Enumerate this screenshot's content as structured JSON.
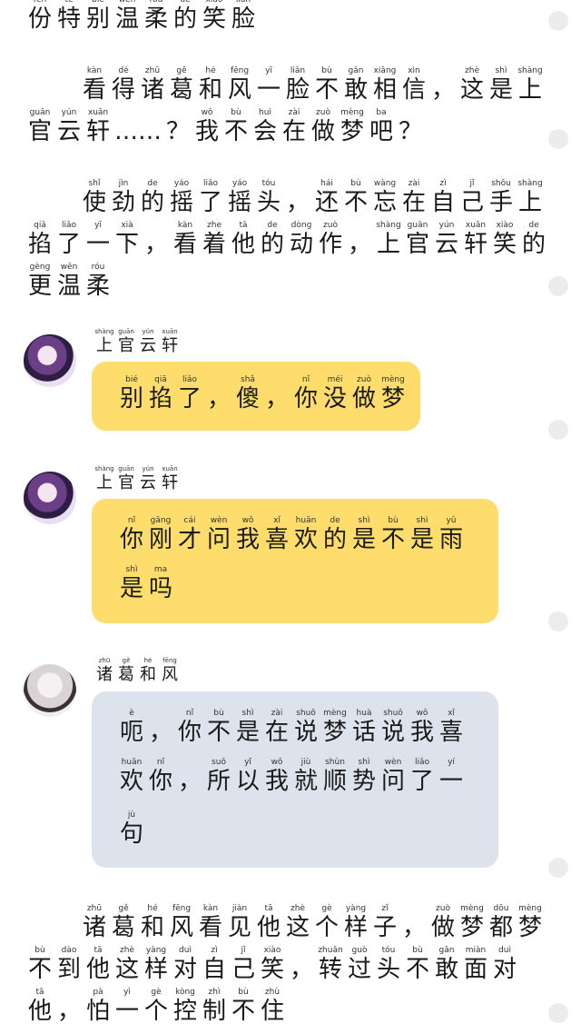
{
  "paragraphs": [
    {
      "lines": [
        {
          "chars": [
            {
              "hz": "份",
              "py": "fèn"
            },
            {
              "hz": "特",
              "py": "tè"
            },
            {
              "hz": "别",
              "py": "bié"
            },
            {
              "hz": "温",
              "py": "wēn"
            },
            {
              "hz": "柔",
              "py": "róu"
            },
            {
              "hz": "的",
              "py": "de"
            },
            {
              "hz": "笑",
              "py": "xiào"
            },
            {
              "hz": "脸",
              "py": "liǎn"
            }
          ]
        }
      ]
    },
    {
      "lines": [
        {
          "chars": [
            {
              "hz": "看",
              "py": "kàn"
            },
            {
              "hz": "得",
              "py": "dé"
            },
            {
              "hz": "诸",
              "py": "zhū"
            },
            {
              "hz": "葛",
              "py": "gě"
            },
            {
              "hz": "和",
              "py": "hé"
            },
            {
              "hz": "风",
              "py": "fēng"
            },
            {
              "hz": "一",
              "py": "yī"
            },
            {
              "hz": "脸",
              "py": "liǎn"
            },
            {
              "hz": "不",
              "py": "bù"
            },
            {
              "hz": "敢",
              "py": "gǎn"
            },
            {
              "hz": "相",
              "py": "xiāng"
            },
            {
              "hz": "信",
              "py": "xìn"
            },
            {
              "hz": "，",
              "py": ""
            },
            {
              "hz": "这",
              "py": "zhè"
            },
            {
              "hz": "是",
              "py": "shì"
            },
            {
              "hz": "上",
              "py": "shàng"
            }
          ]
        },
        {
          "chars": [
            {
              "hz": "官",
              "py": "guān"
            },
            {
              "hz": "云",
              "py": "yún"
            },
            {
              "hz": "轩",
              "py": "xuān"
            },
            {
              "hz": "……",
              "py": ""
            },
            {
              "hz": "？",
              "py": ""
            },
            {
              "hz": "我",
              "py": "wǒ"
            },
            {
              "hz": "不",
              "py": "bù"
            },
            {
              "hz": "会",
              "py": "huì"
            },
            {
              "hz": "在",
              "py": "zài"
            },
            {
              "hz": "做",
              "py": "zuò"
            },
            {
              "hz": "梦",
              "py": "mèng"
            },
            {
              "hz": "吧",
              "py": "ba"
            },
            {
              "hz": "？",
              "py": ""
            }
          ]
        }
      ]
    },
    {
      "lines": [
        {
          "chars": [
            {
              "hz": "使",
              "py": "shǐ"
            },
            {
              "hz": "劲",
              "py": "jìn"
            },
            {
              "hz": "的",
              "py": "de"
            },
            {
              "hz": "摇",
              "py": "yáo"
            },
            {
              "hz": "了",
              "py": "liǎo"
            },
            {
              "hz": "摇",
              "py": "yáo"
            },
            {
              "hz": "头",
              "py": "tóu"
            },
            {
              "hz": "，",
              "py": ""
            },
            {
              "hz": "还",
              "py": "hái"
            },
            {
              "hz": "不",
              "py": "bù"
            },
            {
              "hz": "忘",
              "py": "wàng"
            },
            {
              "hz": "在",
              "py": "zài"
            },
            {
              "hz": "自",
              "py": "zì"
            },
            {
              "hz": "己",
              "py": "jǐ"
            },
            {
              "hz": "手",
              "py": "shǒu"
            },
            {
              "hz": "上",
              "py": "shàng"
            }
          ]
        },
        {
          "chars": [
            {
              "hz": "掐",
              "py": "qiā"
            },
            {
              "hz": "了",
              "py": "liǎo"
            },
            {
              "hz": "一",
              "py": "yī"
            },
            {
              "hz": "下",
              "py": "xià"
            },
            {
              "hz": "，",
              "py": ""
            },
            {
              "hz": "看",
              "py": "kàn"
            },
            {
              "hz": "着",
              "py": "zhe"
            },
            {
              "hz": "他",
              "py": "tā"
            },
            {
              "hz": "的",
              "py": "de"
            },
            {
              "hz": "动",
              "py": "dòng"
            },
            {
              "hz": "作",
              "py": "zuò"
            },
            {
              "hz": "，",
              "py": ""
            },
            {
              "hz": "上",
              "py": "shàng"
            },
            {
              "hz": "官",
              "py": "guān"
            },
            {
              "hz": "云",
              "py": "yún"
            },
            {
              "hz": "轩",
              "py": "xuān"
            },
            {
              "hz": "笑",
              "py": "xiào"
            },
            {
              "hz": "的",
              "py": "de"
            }
          ]
        },
        {
          "chars": [
            {
              "hz": "更",
              "py": "gèng"
            },
            {
              "hz": "温",
              "py": "wēn"
            },
            {
              "hz": "柔",
              "py": "róu"
            }
          ]
        }
      ]
    },
    {
      "lines": [
        {
          "chars": [
            {
              "hz": "诸",
              "py": "zhū"
            },
            {
              "hz": "葛",
              "py": "gě"
            },
            {
              "hz": "和",
              "py": "hé"
            },
            {
              "hz": "风",
              "py": "fēng"
            },
            {
              "hz": "看",
              "py": "kàn"
            },
            {
              "hz": "见",
              "py": "jiàn"
            },
            {
              "hz": "他",
              "py": "tā"
            },
            {
              "hz": "这",
              "py": "zhè"
            },
            {
              "hz": "个",
              "py": "gè"
            },
            {
              "hz": "样",
              "py": "yàng"
            },
            {
              "hz": "子",
              "py": "zǐ"
            },
            {
              "hz": "，",
              "py": ""
            },
            {
              "hz": "做",
              "py": "zuò"
            },
            {
              "hz": "梦",
              "py": "mèng"
            },
            {
              "hz": "都",
              "py": "dōu"
            },
            {
              "hz": "梦",
              "py": "mèng"
            }
          ]
        },
        {
          "chars": [
            {
              "hz": "不",
              "py": "bù"
            },
            {
              "hz": "到",
              "py": "dào"
            },
            {
              "hz": "他",
              "py": "tā"
            },
            {
              "hz": "这",
              "py": "zhè"
            },
            {
              "hz": "样",
              "py": "yàng"
            },
            {
              "hz": "对",
              "py": "duì"
            },
            {
              "hz": "自",
              "py": "zì"
            },
            {
              "hz": "己",
              "py": "jǐ"
            },
            {
              "hz": "笑",
              "py": "xiào"
            },
            {
              "hz": "，",
              "py": ""
            },
            {
              "hz": "转",
              "py": "zhuǎn"
            },
            {
              "hz": "过",
              "py": "guò"
            },
            {
              "hz": "头",
              "py": "tóu"
            },
            {
              "hz": "不",
              "py": "bù"
            },
            {
              "hz": "敢",
              "py": "gǎn"
            },
            {
              "hz": "面",
              "py": "miàn"
            },
            {
              "hz": "对",
              "py": "duì"
            }
          ]
        },
        {
          "chars": [
            {
              "hz": "他",
              "py": "tā"
            },
            {
              "hz": "，",
              "py": ""
            },
            {
              "hz": "怕",
              "py": "pà"
            },
            {
              "hz": "一",
              "py": "yì"
            },
            {
              "hz": "个",
              "py": "gè"
            },
            {
              "hz": "控",
              "py": "kòng"
            },
            {
              "hz": "制",
              "py": "zhì"
            },
            {
              "hz": "不",
              "py": "bù"
            },
            {
              "hz": "住",
              "py": "zhù"
            }
          ]
        }
      ]
    }
  ],
  "messages": [
    {
      "speaker": {
        "chars": [
          {
            "hz": "上",
            "py": "shàng"
          },
          {
            "hz": "官",
            "py": "guān"
          },
          {
            "hz": "云",
            "py": "yún"
          },
          {
            "hz": "轩",
            "py": "xuān"
          }
        ]
      },
      "avatar": "purple-hair-character",
      "lines": [
        {
          "chars": [
            {
              "hz": "别",
              "py": "bié"
            },
            {
              "hz": "掐",
              "py": "qiā"
            },
            {
              "hz": "了",
              "py": "liǎo"
            },
            {
              "hz": "，",
              "py": ""
            },
            {
              "hz": "傻",
              "py": "shǎ"
            },
            {
              "hz": "，",
              "py": ""
            },
            {
              "hz": "你",
              "py": "nǐ"
            },
            {
              "hz": "没",
              "py": "méi"
            },
            {
              "hz": "做",
              "py": "zuò"
            },
            {
              "hz": "梦",
              "py": "mèng"
            }
          ]
        }
      ]
    },
    {
      "speaker": {
        "chars": [
          {
            "hz": "上",
            "py": "shàng"
          },
          {
            "hz": "官",
            "py": "guān"
          },
          {
            "hz": "云",
            "py": "yún"
          },
          {
            "hz": "轩",
            "py": "xuān"
          }
        ]
      },
      "avatar": "purple-hair-character",
      "lines": [
        {
          "chars": [
            {
              "hz": "你",
              "py": "nǐ"
            },
            {
              "hz": "刚",
              "py": "gāng"
            },
            {
              "hz": "才",
              "py": "cái"
            },
            {
              "hz": "问",
              "py": "wèn"
            },
            {
              "hz": "我",
              "py": "wǒ"
            },
            {
              "hz": "喜",
              "py": "xǐ"
            },
            {
              "hz": "欢",
              "py": "huān"
            },
            {
              "hz": "的",
              "py": "de"
            },
            {
              "hz": "是",
              "py": "shì"
            },
            {
              "hz": "不",
              "py": "bù"
            },
            {
              "hz": "是",
              "py": "shì"
            },
            {
              "hz": "雨",
              "py": "yǔ"
            }
          ]
        },
        {
          "chars": [
            {
              "hz": "是",
              "py": "shì"
            },
            {
              "hz": "吗",
              "py": "ma"
            }
          ]
        }
      ]
    },
    {
      "speaker": {
        "chars": [
          {
            "hz": "诸",
            "py": "zhū"
          },
          {
            "hz": "葛",
            "py": "gě"
          },
          {
            "hz": "和",
            "py": "hé"
          },
          {
            "hz": "风",
            "py": "fēng"
          }
        ]
      },
      "avatar": "white-hair-character",
      "lines": [
        {
          "chars": [
            {
              "hz": "呃",
              "py": "è"
            },
            {
              "hz": "，",
              "py": ""
            },
            {
              "hz": "你",
              "py": "nǐ"
            },
            {
              "hz": "不",
              "py": "bù"
            },
            {
              "hz": "是",
              "py": "shì"
            },
            {
              "hz": "在",
              "py": "zài"
            },
            {
              "hz": "说",
              "py": "shuō"
            },
            {
              "hz": "梦",
              "py": "mèng"
            },
            {
              "hz": "话",
              "py": "huà"
            },
            {
              "hz": "说",
              "py": "shuō"
            },
            {
              "hz": "我",
              "py": "wǒ"
            },
            {
              "hz": "喜",
              "py": "xǐ"
            }
          ]
        },
        {
          "chars": [
            {
              "hz": "欢",
              "py": "huān"
            },
            {
              "hz": "你",
              "py": "nǐ"
            },
            {
              "hz": "，",
              "py": ""
            },
            {
              "hz": "所",
              "py": "suǒ"
            },
            {
              "hz": "以",
              "py": "yǐ"
            },
            {
              "hz": "我",
              "py": "wǒ"
            },
            {
              "hz": "就",
              "py": "jiù"
            },
            {
              "hz": "顺",
              "py": "shùn"
            },
            {
              "hz": "势",
              "py": "shì"
            },
            {
              "hz": "问",
              "py": "wèn"
            },
            {
              "hz": "了",
              "py": "liǎo"
            },
            {
              "hz": "一",
              "py": "yí"
            }
          ]
        },
        {
          "chars": [
            {
              "hz": "句",
              "py": "jù"
            }
          ]
        }
      ]
    }
  ],
  "colors": {
    "yellow_bubble": "#ffdd6c",
    "blue_bubble": "#dde3ec"
  }
}
